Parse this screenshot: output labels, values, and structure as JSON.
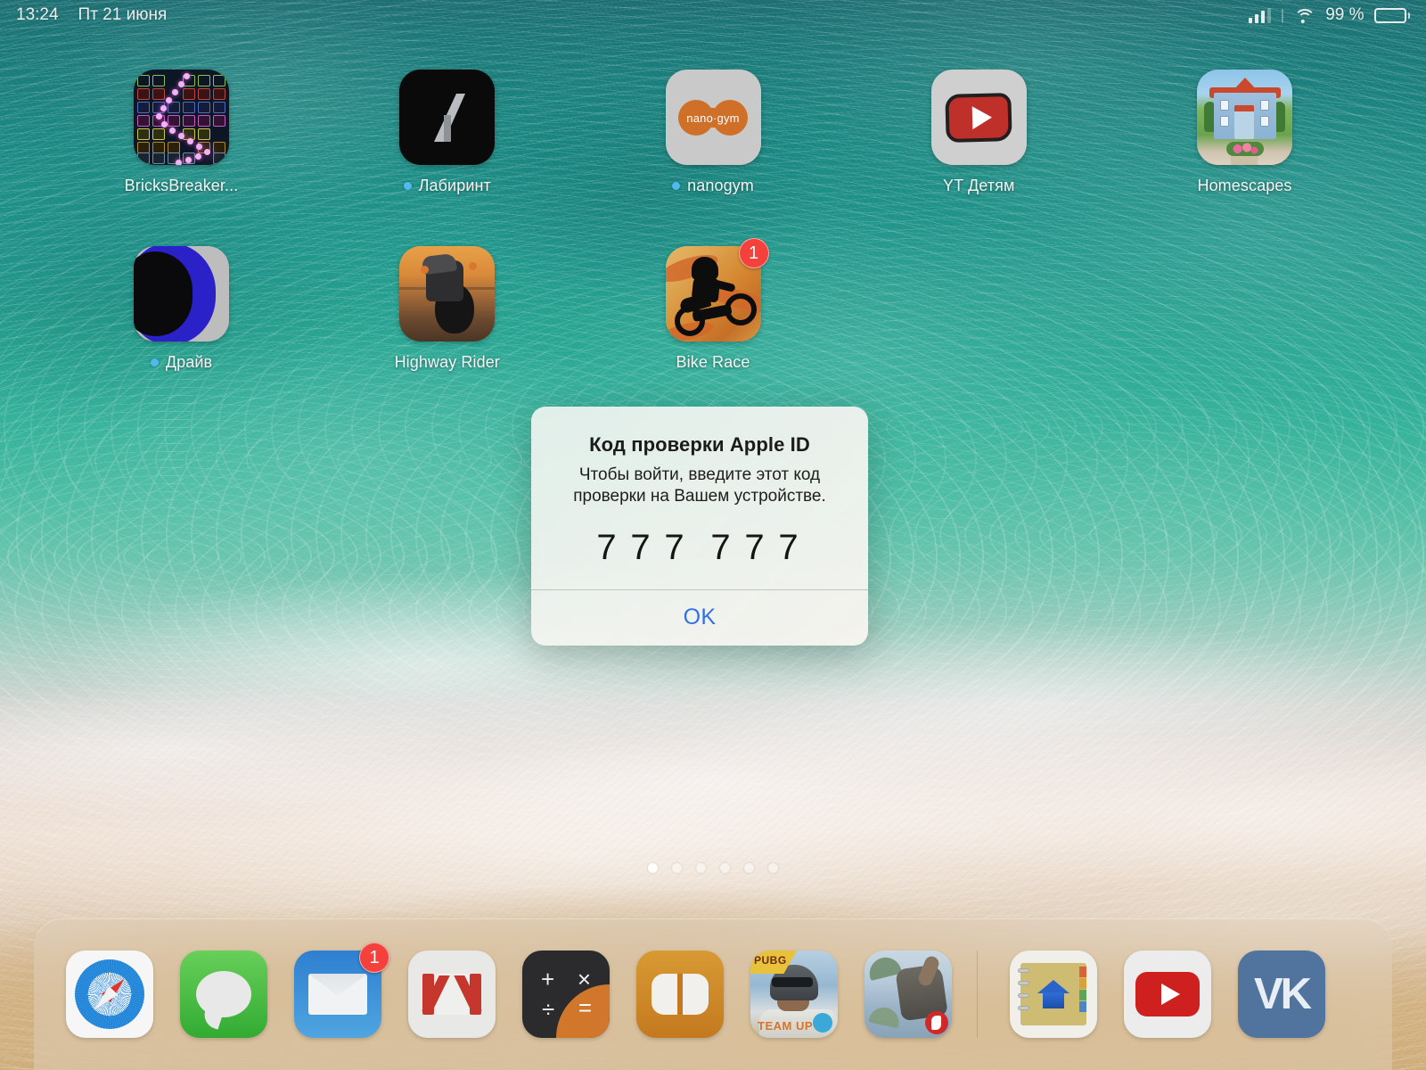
{
  "status_bar": {
    "time": "13:24",
    "date": "Пт 21 июня",
    "battery_percent": "99 %",
    "signal_icon": "cellular-signal-icon",
    "wifi_icon": "wifi-icon",
    "battery_icon": "battery-icon"
  },
  "home_screen": {
    "rows": [
      [
        {
          "label": "BricksBreaker...",
          "icon": "bricksbreaker-icon",
          "new_dot": false,
          "badge": null
        },
        {
          "label": "Лабиринт",
          "icon": "labirint-icon",
          "new_dot": true,
          "badge": null
        },
        {
          "label": "nanogym",
          "icon": "nanogym-icon",
          "new_dot": true,
          "badge": null,
          "icon_text": "nano·gym"
        },
        {
          "label": "YT Детям",
          "icon": "youtube-kids-icon",
          "new_dot": false,
          "badge": null
        },
        {
          "label": "Homescapes",
          "icon": "homescapes-icon",
          "new_dot": false,
          "badge": null
        }
      ],
      [
        {
          "label": "Драйв",
          "icon": "drive-icon",
          "new_dot": true,
          "badge": null
        },
        {
          "label": "Highway Rider",
          "icon": "highway-rider-icon",
          "new_dot": false,
          "badge": null
        },
        {
          "label": "Bike Race",
          "icon": "bike-race-icon",
          "new_dot": false,
          "badge": "1"
        }
      ]
    ],
    "page_dots": {
      "count": 6,
      "active_index": 0
    }
  },
  "dock": {
    "apps": [
      {
        "name": "Safari",
        "icon": "safari-icon",
        "badge": null
      },
      {
        "name": "Сообщения",
        "icon": "messages-icon",
        "badge": null
      },
      {
        "name": "Почта",
        "icon": "mail-icon",
        "badge": "1"
      },
      {
        "name": "Gmail",
        "icon": "gmail-icon",
        "badge": null
      },
      {
        "name": "Калькулятор",
        "icon": "calculator-icon",
        "badge": null
      },
      {
        "name": "Книги",
        "icon": "books-icon",
        "badge": null
      },
      {
        "name": "PUBG MOBILE",
        "icon": "pubg-icon",
        "badge": null,
        "icon_text": "PUBG",
        "icon_subtext": "TEAM UP"
      },
      {
        "name": "Free Fire",
        "icon": "free-fire-icon",
        "badge": null
      }
    ],
    "recent_apps": [
      {
        "name": "Контакты",
        "icon": "notebook-home-icon",
        "badge": null
      },
      {
        "name": "YouTube",
        "icon": "youtube-icon",
        "badge": null
      },
      {
        "name": "VK",
        "icon": "vk-icon",
        "badge": null,
        "icon_text": "VK"
      }
    ]
  },
  "alert": {
    "title": "Код проверки Apple ID",
    "message": "Чтобы войти, введите этот код проверки на Вашем устройстве.",
    "code_digits": [
      "7",
      "7",
      "7",
      "7",
      "7",
      "7"
    ],
    "ok_label": "OK",
    "ok_color": "#3370e0"
  }
}
